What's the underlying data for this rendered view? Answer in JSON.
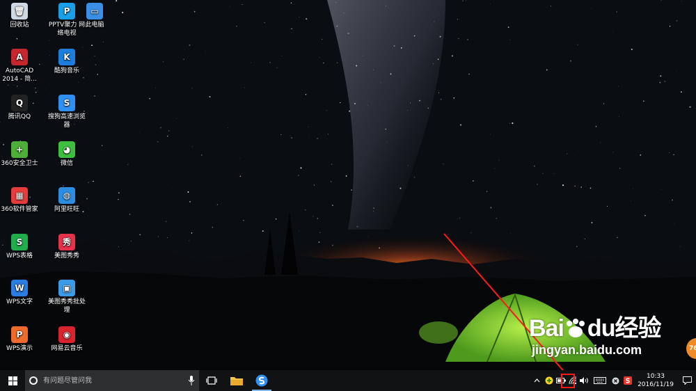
{
  "desktop": {
    "icons": [
      {
        "label": "回收站",
        "icon": "recycle-bin-icon",
        "color": "#cfd8e3",
        "glyph": "🗑"
      },
      {
        "label": "PPTV聚力 网络电视",
        "icon": "pptv-icon",
        "color": "#1aa0e8",
        "glyph": "P"
      },
      {
        "label": "此电脑",
        "icon": "this-pc-icon",
        "color": "#3a8ee6",
        "glyph": "▭"
      },
      {
        "label": "AutoCAD 2014 - 简...",
        "icon": "autocad-icon",
        "color": "#c6262e",
        "glyph": "A"
      },
      {
        "label": "酷狗音乐",
        "icon": "kugou-icon",
        "color": "#1c7fe0",
        "glyph": "K"
      },
      {
        "label": "腾讯QQ",
        "icon": "qq-penguin-icon",
        "color": "#222222",
        "glyph": "Q"
      },
      {
        "label": "搜狗高速浏览器",
        "icon": "sogou-browser-icon",
        "color": "#2f8ff2",
        "glyph": "S"
      },
      {
        "label": "360安全卫士",
        "icon": "360-safe-icon",
        "color": "#4caf37",
        "glyph": "+"
      },
      {
        "label": "微信",
        "icon": "wechat-icon",
        "color": "#3fbf3f",
        "glyph": "◕"
      },
      {
        "label": "360软件管家",
        "icon": "360-software-manager-icon",
        "color": "#e63c3c",
        "glyph": "▦"
      },
      {
        "label": "阿里旺旺",
        "icon": "aliwangwang-icon",
        "color": "#2d8de0",
        "glyph": "◍"
      },
      {
        "label": "WPS表格",
        "icon": "wps-spreadsheet-icon",
        "color": "#1fae4b",
        "glyph": "S"
      },
      {
        "label": "美图秀秀",
        "icon": "meitu-icon",
        "color": "#e6324b",
        "glyph": "秀"
      },
      {
        "label": "WPS文字",
        "icon": "wps-writer-icon",
        "color": "#2a7de1",
        "glyph": "W"
      },
      {
        "label": "美图秀秀批处理",
        "icon": "meitu-batch-icon",
        "color": "#3b9be6",
        "glyph": "▣"
      },
      {
        "label": "WPS演示",
        "icon": "wps-presentation-icon",
        "color": "#ee6b2d",
        "glyph": "P"
      },
      {
        "label": "网易云音乐",
        "icon": "netease-music-icon",
        "color": "#d9232d",
        "glyph": "◉"
      }
    ]
  },
  "watermark": {
    "brand": "Bai",
    "brand_suffix": "du",
    "brand_cn": "经验",
    "site": "jingyan.baidu.com"
  },
  "side_badge": "76",
  "taskbar": {
    "search_placeholder": "有问题尽管问我",
    "clock_time": "10:33",
    "clock_date": "2016/11/19",
    "tray_up_arrow": "^",
    "colors": {
      "bg": "#101214",
      "search_bg": "#2d2f31",
      "highlight": "#ff1a1a"
    }
  }
}
